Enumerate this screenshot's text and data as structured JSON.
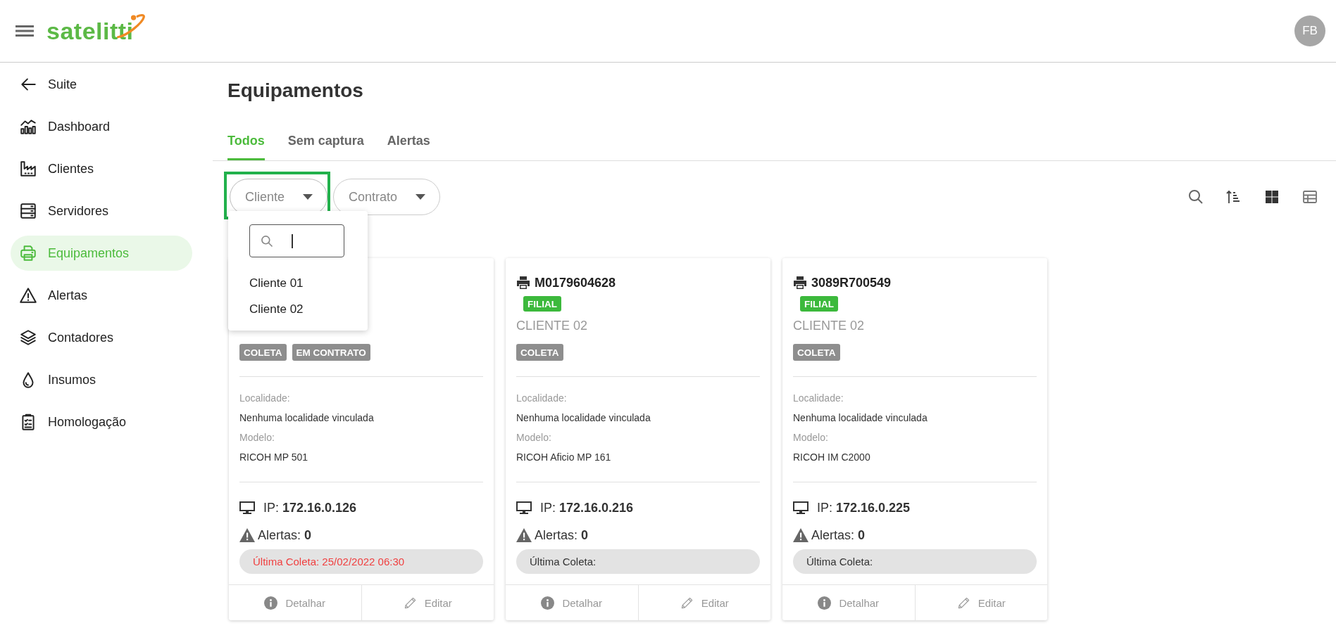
{
  "header": {
    "logo": "satelitti",
    "avatar": "FB"
  },
  "sidebar": {
    "back": "Suite",
    "items": [
      {
        "label": "Dashboard",
        "selected": false
      },
      {
        "label": "Clientes",
        "selected": false
      },
      {
        "label": "Servidores",
        "selected": false
      },
      {
        "label": "Equipamentos",
        "selected": true
      },
      {
        "label": "Alertas",
        "selected": false
      },
      {
        "label": "Contadores",
        "selected": false
      },
      {
        "label": "Insumos",
        "selected": false
      },
      {
        "label": "Homologação",
        "selected": false
      }
    ]
  },
  "page": {
    "title": "Equipamentos"
  },
  "tabs": [
    {
      "label": "Todos",
      "selected": true
    },
    {
      "label": "Sem captura",
      "selected": false
    },
    {
      "label": "Alertas",
      "selected": false
    }
  ],
  "filters": [
    {
      "label": "Cliente",
      "open": true
    },
    {
      "label": "Contrato",
      "open": false
    }
  ],
  "dropdown": {
    "options": [
      "Cliente 01",
      "Cliente 02"
    ]
  },
  "views": [
    {
      "kind": "grid",
      "selected": true
    },
    {
      "kind": "table",
      "selected": false
    }
  ],
  "cards": [
    {
      "tags": [
        "COLETA",
        "EM CONTRATO"
      ],
      "location_label": "Localidade:",
      "location": "Nenhuma localidade vinculada",
      "model_label": "Modelo:",
      "model": "RICOH MP 501",
      "ip": "IP: **172.16.0.126**",
      "alerts": "Alertas: **0**",
      "last_collection": "Última Coleta: 25/02/2022 06:30",
      "late": true,
      "actions": [
        "Detalhar",
        "Editar"
      ]
    },
    {
      "serial": "M0179604628",
      "branch_tag": "FILIAL",
      "client": "CLIENTE 02",
      "tags": [
        "COLETA"
      ],
      "location_label": "Localidade:",
      "location": "Nenhuma localidade vinculada",
      "model_label": "Modelo:",
      "model": "RICOH Aficio MP 161",
      "ip": "IP: **172.16.0.216**",
      "alerts": "Alertas: **0**",
      "last_collection": "Última Coleta:",
      "late": false,
      "actions": [
        "Detalhar",
        "Editar"
      ]
    },
    {
      "serial": "3089R700549",
      "branch_tag": "FILIAL",
      "client": "CLIENTE 02",
      "tags": [
        "COLETA"
      ],
      "location_label": "Localidade:",
      "location": "Nenhuma localidade vinculada",
      "model_label": "Modelo:",
      "model": "RICOH IM C2000",
      "ip": "IP: **172.16.0.225**",
      "alerts": "Alertas: **0**",
      "last_collection": "Última Coleta:",
      "late": false,
      "actions": [
        "Detalhar",
        "Editar"
      ]
    }
  ]
}
